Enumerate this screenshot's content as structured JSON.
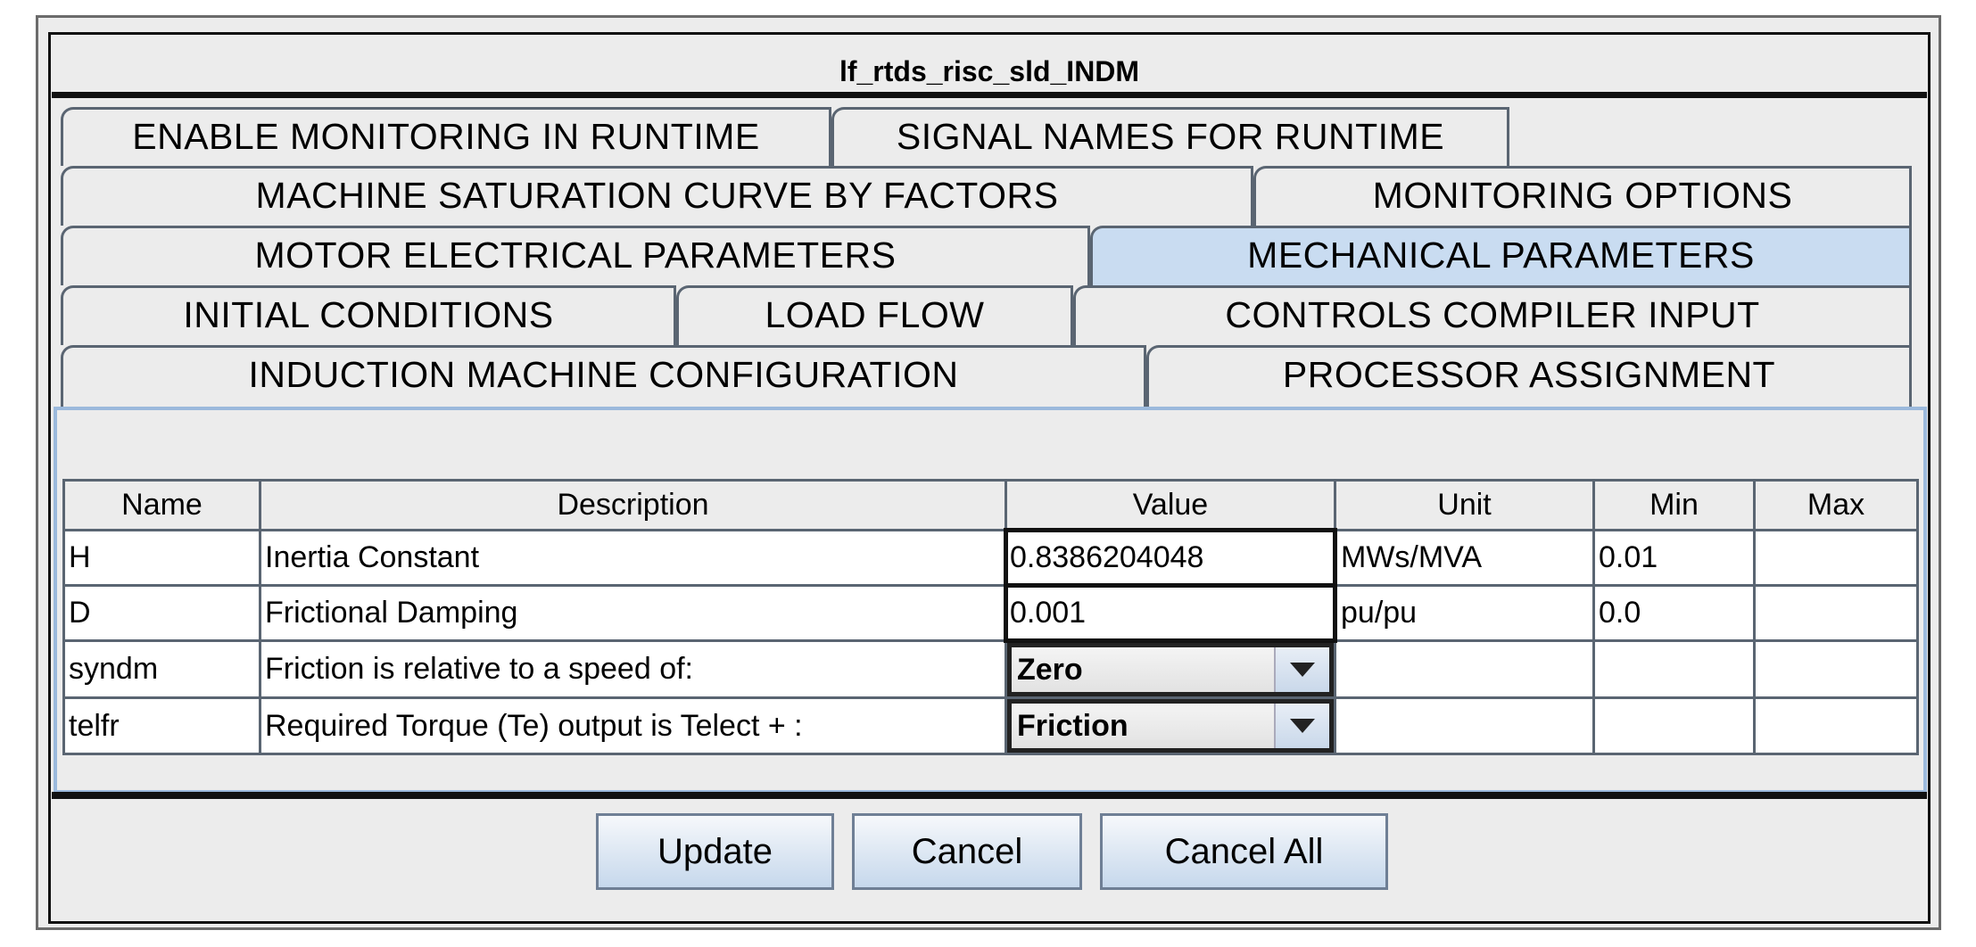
{
  "window": {
    "title": "lf_rtds_risc_sld_INDM"
  },
  "tabs": {
    "row1": [
      {
        "label": "ENABLE MONITORING IN RUNTIME"
      },
      {
        "label": "SIGNAL NAMES FOR RUNTIME"
      }
    ],
    "row2": [
      {
        "label": "MACHINE SATURATION CURVE BY FACTORS"
      },
      {
        "label": "MONITORING OPTIONS"
      }
    ],
    "row3": [
      {
        "label": "MOTOR ELECTRICAL PARAMETERS"
      },
      {
        "label": "MECHANICAL PARAMETERS",
        "selected": true
      }
    ],
    "row4": [
      {
        "label": "INITIAL CONDITIONS"
      },
      {
        "label": "LOAD FLOW"
      },
      {
        "label": "CONTROLS COMPILER INPUT"
      }
    ],
    "row5": [
      {
        "label": "INDUCTION MACHINE CONFIGURATION"
      },
      {
        "label": "PROCESSOR ASSIGNMENT"
      }
    ]
  },
  "table": {
    "headers": [
      "Name",
      "Description",
      "Value",
      "Unit",
      "Min",
      "Max"
    ],
    "rows": [
      {
        "name": "H",
        "description": "Inertia Constant",
        "value": "0.8386204048",
        "unit": "MWs/MVA",
        "min": "0.01",
        "max": ""
      },
      {
        "name": "D",
        "description": "Frictional Damping",
        "value": "0.001",
        "unit": "pu/pu",
        "min": "0.0",
        "max": ""
      },
      {
        "name": "syndm",
        "description": "Friction is relative to a speed of:",
        "value": "Zero",
        "unit": "",
        "min": "",
        "max": ""
      },
      {
        "name": "telfr",
        "description": "Required Torque (Te) output is Telect + :",
        "value": "Friction",
        "unit": "",
        "min": "",
        "max": ""
      }
    ]
  },
  "buttons": {
    "update": "Update",
    "cancel": "Cancel",
    "cancel_all": "Cancel All"
  },
  "colors": {
    "selected_tab": "#c9dcf1",
    "panel_border": "#9bb9dc"
  }
}
